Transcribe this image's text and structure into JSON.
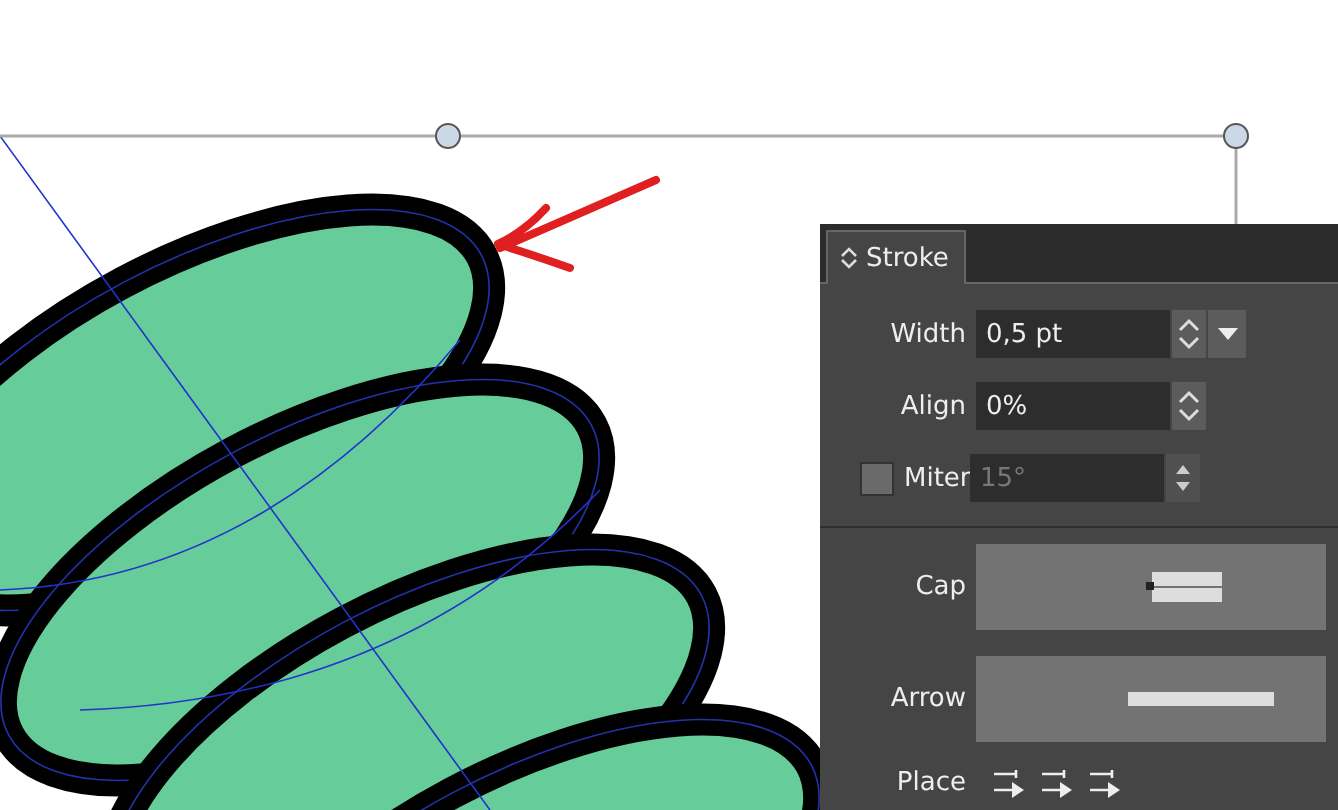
{
  "panel": {
    "tab": {
      "label": "Stroke",
      "selected": true
    },
    "width": {
      "label": "Width",
      "value": "0,5 pt"
    },
    "align": {
      "label": "Align",
      "value": "0%"
    },
    "miter": {
      "label": "Miter",
      "value": "15°",
      "checked": false,
      "disabled": true
    },
    "cap": {
      "label": "Cap"
    },
    "arrow": {
      "label": "Arrow"
    },
    "place": {
      "label": "Place"
    }
  }
}
